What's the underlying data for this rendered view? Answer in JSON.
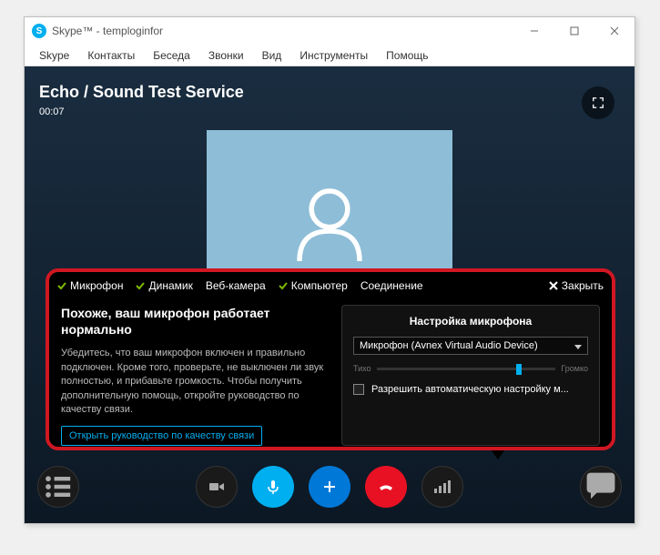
{
  "window": {
    "title": "Skype™ - temploginfor"
  },
  "menu": {
    "items": [
      "Skype",
      "Контакты",
      "Беседа",
      "Звонки",
      "Вид",
      "Инструменты",
      "Помощь"
    ]
  },
  "call": {
    "title": "Echo / Sound Test Service",
    "time": "00:07"
  },
  "panel": {
    "tabs": {
      "mic": "Микрофон",
      "speaker": "Динамик",
      "webcam": "Веб-камера",
      "computer": "Компьютер",
      "connection": "Соединение",
      "close": "Закрыть"
    },
    "left": {
      "heading": "Похоже, ваш микрофон работает нормально",
      "body": "Убедитесь, что ваш микрофон включен и правильно подключен. Кроме того, проверьте, не выключен ли звук полностью, и прибавьте громкость. Чтобы получить дополнительную помощь, откройте руководство по качеству связи.",
      "guide": "Открыть руководство по качеству связи"
    },
    "right": {
      "title": "Настройка микрофона",
      "device": "Микрофон (Avnex Virtual Audio Device)",
      "slider_min": "Тихо",
      "slider_max": "Громко",
      "checkbox": "Разрешить автоматическую настройку м..."
    }
  }
}
